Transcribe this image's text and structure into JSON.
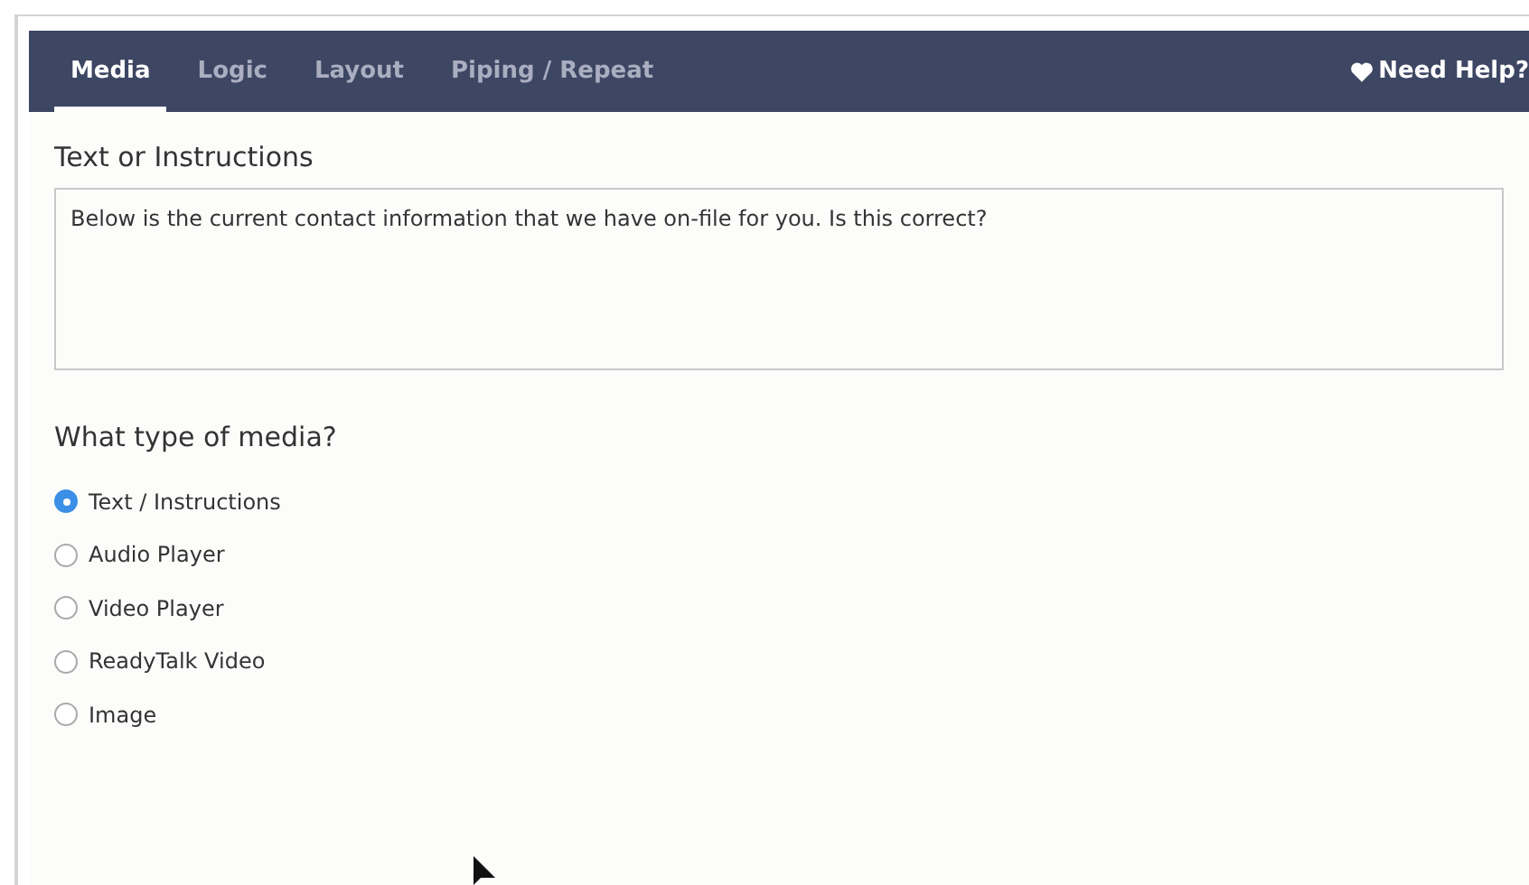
{
  "tabs": [
    {
      "label": "Media",
      "selected": true
    },
    {
      "label": "Logic",
      "selected": false
    },
    {
      "label": "Layout",
      "selected": false
    },
    {
      "label": "Piping / Repeat",
      "selected": false
    }
  ],
  "help_link": "Need Help?",
  "text_section": {
    "label": "Text or Instructions",
    "value": "Below is the current contact information that we have on-file for you. Is this correct?"
  },
  "media_section": {
    "label": "What type of media?",
    "options": [
      {
        "label": "Text / Instructions",
        "selected": true
      },
      {
        "label": "Audio Player",
        "selected": false
      },
      {
        "label": "Video Player",
        "selected": false
      },
      {
        "label": "ReadyTalk Video",
        "selected": false
      },
      {
        "label": "Image",
        "selected": false
      }
    ]
  }
}
